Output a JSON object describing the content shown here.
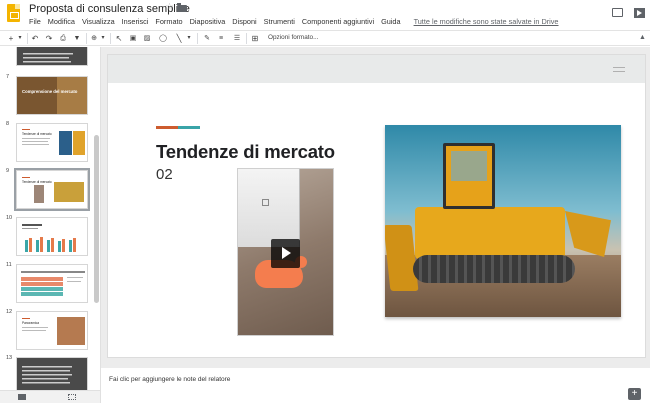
{
  "header": {
    "title": "Proposta di consulenza semplice",
    "menu": [
      "File",
      "Modifica",
      "Visualizza",
      "Inserisci",
      "Formato",
      "Diapositiva",
      "Disponi",
      "Strumenti",
      "Componenti aggiuntivi",
      "Guida"
    ],
    "save_status": "Tutte le modifiche sono state salvate in Drive"
  },
  "toolbar": {
    "new_slide": "+",
    "options_label": "Opzioni formato...",
    "icons": [
      "add-icon",
      "undo-icon",
      "redo-icon",
      "print-icon",
      "paint-format-icon",
      "zoom-icon",
      "select-icon",
      "textbox-icon",
      "image-icon",
      "shape-icon",
      "line-icon",
      "pen-icon",
      "align-icon",
      "list-icon",
      "comment-add-icon",
      "collapse-icon"
    ]
  },
  "filmstrip": {
    "numbers": [
      "7",
      "8",
      "9",
      "10",
      "11",
      "12",
      "13"
    ],
    "slide7_title": "Comprensione del mercato",
    "slide8_title": "Tendenze di mercato",
    "slide9_title": "Tendenze di mercato",
    "slide12_title": "Panoramica"
  },
  "slide": {
    "title": "Tendenze di mercato",
    "number": "02"
  },
  "notes": {
    "placeholder": "Fai clic per aggiungere le note del relatore"
  },
  "colors": {
    "accent_orange": "#cd5c2f",
    "accent_teal": "#39a4a8",
    "logo_yellow": "#f4b400"
  }
}
